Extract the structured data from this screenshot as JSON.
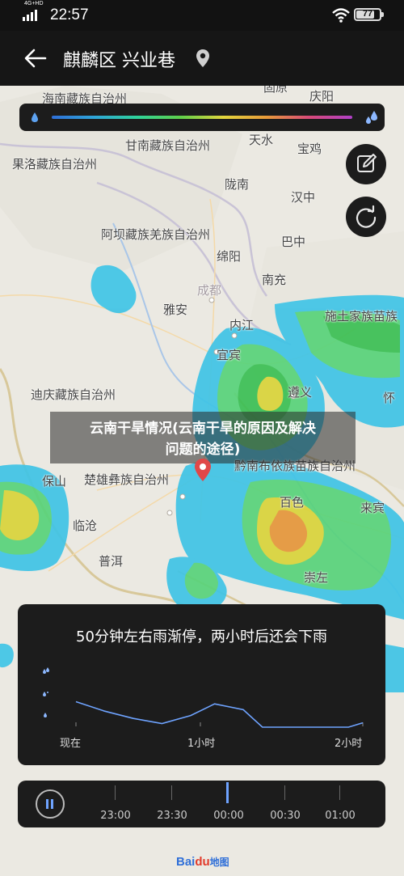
{
  "status_bar": {
    "network_label": "4G+HD",
    "time": "22:57",
    "battery_level": "77",
    "battery_fraction": 0.77
  },
  "header": {
    "location_title": "麒麟区 兴业巷",
    "back_icon": "arrow-left-icon",
    "pin_icon": "location-pin-icon"
  },
  "map": {
    "places": [
      "海南藏族自治州",
      "固原",
      "庆阳",
      "甘南藏族自治州",
      "天水",
      "宝鸡",
      "果洛藏族自治州",
      "陇南",
      "汉中",
      "阿坝藏族羌族自治州",
      "巴中",
      "绵阳",
      "南充",
      "成都",
      "雅安",
      "内江",
      "宜宾",
      "施土家族苗族",
      "遵义",
      "迪庆藏族自治州",
      "怀",
      "黔南布依族苗族自治州",
      "保山",
      "楚雄彝族自治州",
      "临沧",
      "百色",
      "来宾",
      "普洱",
      "崇左"
    ]
  },
  "legend": {
    "left_icon": "light-rain-drop-icon",
    "right_icon": "heavy-rain-drops-icon",
    "colors": [
      "#2f6fd8",
      "#2fa6d8",
      "#2fd39a",
      "#5fd04a",
      "#e2d53d",
      "#e89b3a",
      "#d84a7a",
      "#b040c8"
    ]
  },
  "buttons": {
    "edit_icon": "edit-pencil-icon",
    "refresh_icon": "refresh-icon"
  },
  "watermark": {
    "line1": "云南干旱情况(云南干旱的原因及解决",
    "line2": "问题的途径)"
  },
  "forecast": {
    "title": "50分钟左右雨渐停，两小时后还会下雨",
    "x_labels": [
      "现在",
      "1小时",
      "2小时"
    ],
    "level_icons": [
      "heavy-rain-icon",
      "moderate-rain-icon",
      "light-rain-icon"
    ]
  },
  "chart_data": {
    "type": "line",
    "title": "50分钟左右雨渐停，两小时后还会下雨",
    "xlabel": "",
    "ylabel": "",
    "x_unit": "minutes from now",
    "x": [
      0,
      12,
      24,
      36,
      48,
      58,
      70,
      78,
      84,
      96,
      108,
      114,
      120
    ],
    "y": [
      0.35,
      0.22,
      0.12,
      0.05,
      0.16,
      0.32,
      0.24,
      0.0,
      0.0,
      0.0,
      0.0,
      0.0,
      0.06
    ],
    "xlim": [
      0,
      120
    ],
    "ylim": [
      0,
      1
    ],
    "tick_labels": [
      "现在",
      "1小时",
      "2小时"
    ],
    "grid": false,
    "line_color": "#6ea3ff"
  },
  "timeline": {
    "play_icon": "pause-icon",
    "times": [
      "23:00",
      "23:30",
      "00:00",
      "00:30",
      "01:00"
    ],
    "current_position": 0.5
  },
  "logo": {
    "text_a": "Bai",
    "text_b": "du",
    "text_c": "地图"
  }
}
